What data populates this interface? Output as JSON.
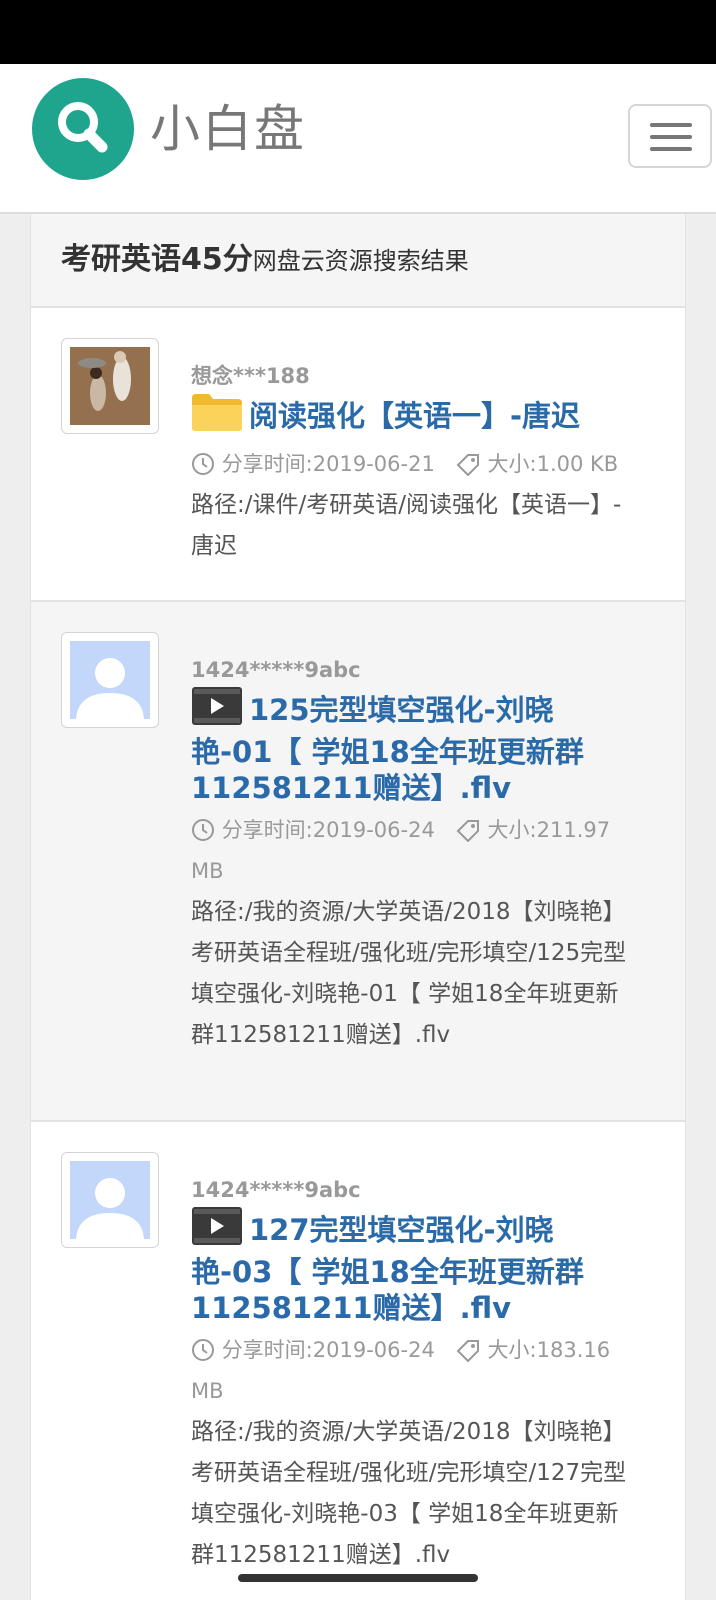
{
  "brand": {
    "name": "小白盘"
  },
  "search": {
    "keyword": "考研英语45分",
    "suffix": "网盘云资源搜索结果"
  },
  "results": [
    {
      "user": "想念***188",
      "icon": "folder-icon",
      "title": "阅读强化【英语一】-唐迟",
      "time": "分享时间:2019-06-21",
      "size": "大小:1.00 KB",
      "path": "路径:/课件/考研英语/阅读强化【英语一】-唐迟"
    },
    {
      "user": "1424*****9abc",
      "icon": "video-file-icon",
      "title": "125完型填空强化-刘晓艳-01【 学姐18全年班更新群112581211赠送】.flv",
      "time": "分享时间:2019-06-24",
      "size": "大小:211.97 MB",
      "path": "路径:/我的资源/大学英语/2018【刘晓艳】考研英语全程班/强化班/完形填空/125完型填空强化-刘晓艳-01【 学姐18全年班更新群112581211赠送】.flv"
    },
    {
      "user": "1424*****9abc",
      "icon": "video-file-icon",
      "title": "127完型填空强化-刘晓艳-03【 学姐18全年班更新群112581211赠送】.flv",
      "time": "分享时间:2019-06-24",
      "size": "大小:183.16 MB",
      "path": "路径:/我的资源/大学英语/2018【刘晓艳】考研英语全程班/强化班/完形填空/127完型填空强化-刘晓艳-03【 学姐18全年班更新群112581211赠送】.flv"
    }
  ],
  "colors": {
    "brand_green": "#1fa58d",
    "link_blue": "#2a6aa8"
  }
}
